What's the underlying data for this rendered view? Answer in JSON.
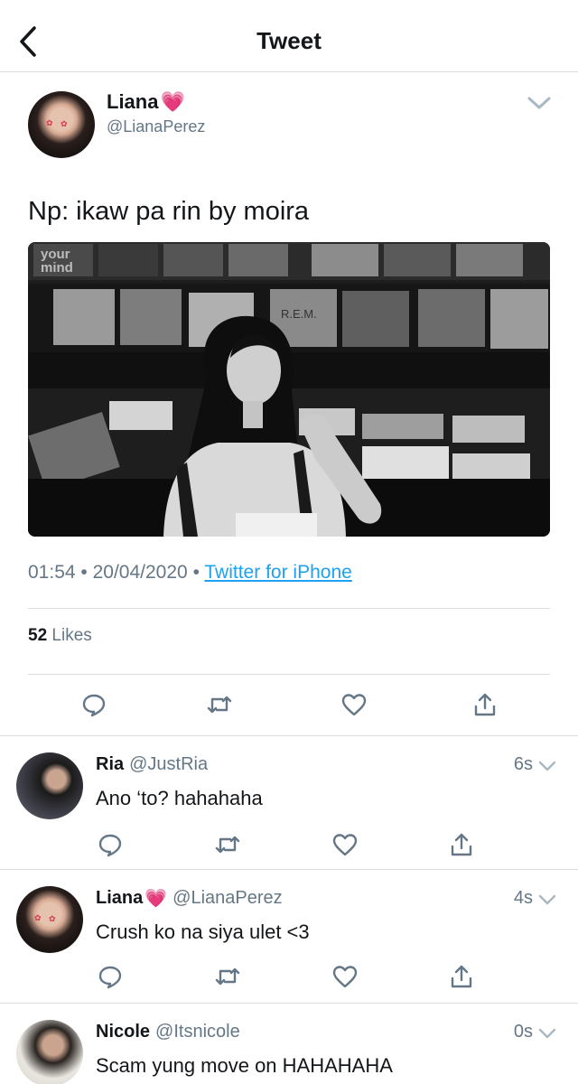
{
  "header": {
    "title": "Tweet",
    "back_icon": "chevron-left-icon"
  },
  "tweet": {
    "name": "Liana",
    "name_emoji": "💗",
    "handle": "@LianaPerez",
    "text": "Np: ikaw pa rin by moira",
    "media": {
      "description_icon": "photo",
      "signs": [
        "your mind",
        "R.E.M."
      ]
    },
    "time": "01:54",
    "date": "20/04/2020",
    "separator": "•",
    "source": "Twitter for iPhone",
    "likes_count": "52",
    "likes_label": "Likes"
  },
  "actions": [
    "reply-icon",
    "retweet-icon",
    "like-icon",
    "share-icon"
  ],
  "replies": [
    {
      "name": "Ria",
      "name_emoji": "",
      "handle": "@JustRia",
      "time": "6s",
      "text": "Ano ‘to? hahahaha"
    },
    {
      "name": "Liana",
      "name_emoji": "💗",
      "handle": "@LianaPerez",
      "time": "4s",
      "text": "Crush ko na siya ulet <3"
    },
    {
      "name": "Nicole",
      "name_emoji": "",
      "handle": "@Itsnicole",
      "time": "0s",
      "text": "Scam yung move on HAHAHAHA"
    }
  ],
  "colors": {
    "link": "#1da1f2",
    "secondary_text": "#657786",
    "divider": "#dcdcdc",
    "heart": "#ff5fa8"
  }
}
